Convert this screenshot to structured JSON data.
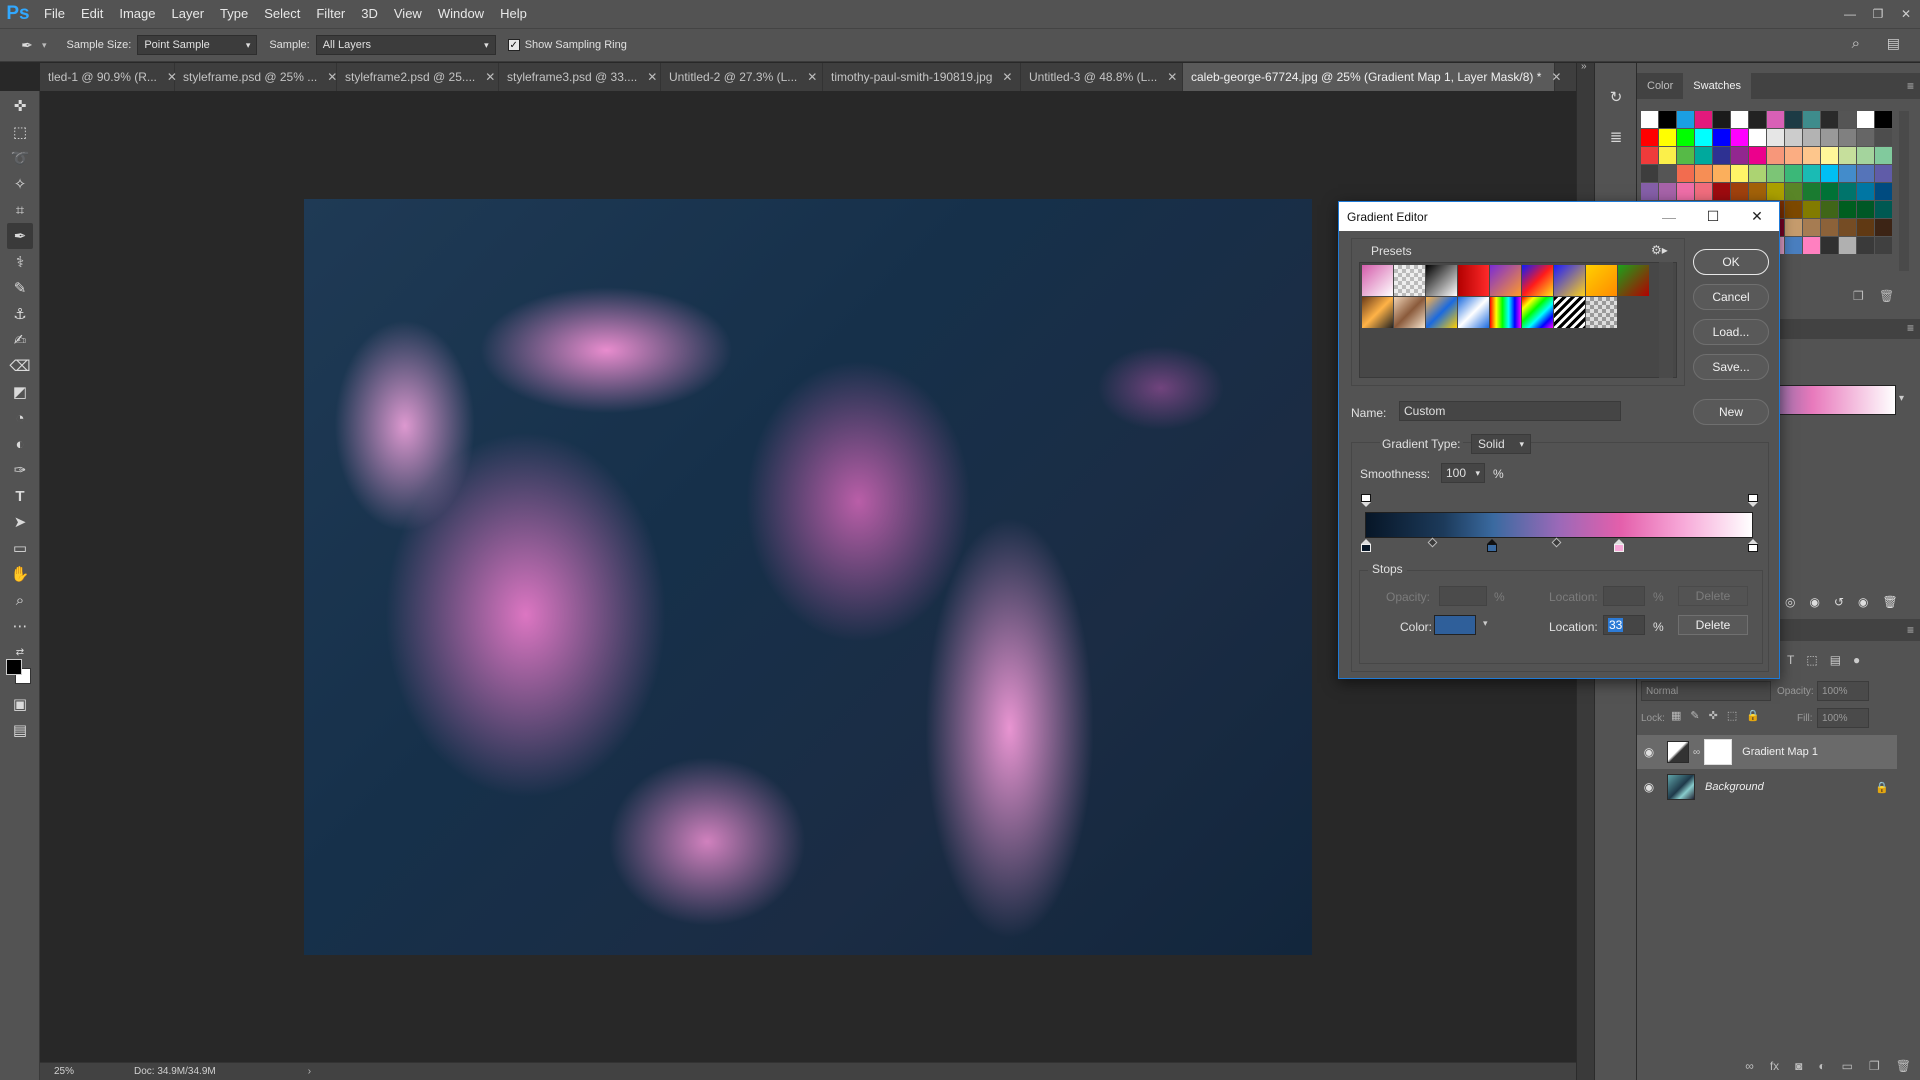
{
  "app": {
    "logo": "Ps"
  },
  "menu": [
    "File",
    "Edit",
    "Image",
    "Layer",
    "Type",
    "Select",
    "Filter",
    "3D",
    "View",
    "Window",
    "Help"
  ],
  "options_bar": {
    "sample_size_label": "Sample Size:",
    "sample_size_value": "Point Sample",
    "sample_label": "Sample:",
    "sample_value": "All Layers",
    "sampling_ring_label": "Show Sampling Ring",
    "sampling_ring_checked": true
  },
  "tabs": [
    {
      "label": "tled-1 @ 90.9% (R...",
      "active": false
    },
    {
      "label": "styleframe.psd @ 25% ...",
      "active": false
    },
    {
      "label": "styleframe2.psd @ 25....",
      "active": false
    },
    {
      "label": "styleframe3.psd @ 33....",
      "active": false
    },
    {
      "label": "Untitled-2 @ 27.3% (L...",
      "active": false
    },
    {
      "label": "timothy-paul-smith-190819.jpg",
      "active": false
    },
    {
      "label": "Untitled-3 @ 48.8% (L...",
      "active": false
    },
    {
      "label": "caleb-george-67724.jpg @ 25% (Gradient Map 1, Layer Mask/8) *",
      "active": true
    }
  ],
  "status": {
    "zoom": "25%",
    "doc": "Doc: 34.9M/34.9M"
  },
  "panels": {
    "color_tab": "Color",
    "swatches_tab": "Swatches"
  },
  "swatch_colors": [
    "#ffffff",
    "#000000",
    "#1a9fe3",
    "#e3197c",
    "#1b1b1b",
    "#ffffff",
    "#222222",
    "#d860b6",
    "#1d3b45",
    "#3e8c8c",
    "#2a2a2a",
    "#555555",
    "#ffffff",
    "#000000",
    "#ff0000",
    "#ffff00",
    "#00ff00",
    "#00ffff",
    "#0000ff",
    "#ff00ff",
    "#ffffff",
    "#e6e6e6",
    "#cccccc",
    "#b3b3b3",
    "#999999",
    "#808080",
    "#666666",
    "#4d4d4d",
    "#ef3b3b",
    "#fbef4a",
    "#56ba47",
    "#00a99d",
    "#2e3192",
    "#92278f",
    "#ec008c",
    "#f7977a",
    "#fbad82",
    "#fdc68c",
    "#fff799",
    "#c6df9c",
    "#a4d49d",
    "#81ca9d",
    "#3d3d3d",
    "#555555",
    "#f26c4f",
    "#f68e55",
    "#fbaf5c",
    "#fff467",
    "#acd372",
    "#7cc576",
    "#3bb878",
    "#1abbb4",
    "#00bff3",
    "#438ccb",
    "#5574b9",
    "#605ca8",
    "#855fa8",
    "#a763a9",
    "#ef6ea8",
    "#f16d7e",
    "#9e0b0f",
    "#a0410d",
    "#a36209",
    "#aba000",
    "#598527",
    "#1a7b30",
    "#007236",
    "#00746b",
    "#0076a3",
    "#004b80",
    "#003471",
    "#1b1464",
    "#440e62",
    "#630460",
    "#9e005d",
    "#9e0039",
    "#790000",
    "#7b2e00",
    "#7d4900",
    "#827b00",
    "#406618",
    "#005e20",
    "#005826",
    "#005952",
    "#005b7f",
    "#003663",
    "#002157",
    "#0d004c",
    "#32004b",
    "#4b0049",
    "#7b0046",
    "#7a0026",
    "#c69c6d",
    "#a67c52",
    "#8c6239",
    "#754c24",
    "#603913",
    "#3c2415",
    "#a0410d",
    "#7d4900",
    "#8c6239",
    "#3c2415",
    "#c69c6d",
    "#603913",
    "#1a1a1a",
    "#e5a0c9",
    "#4a7fc0",
    "#ff80c0",
    "#303030",
    "#b0b0b0",
    "#3a3a3a",
    "#404040"
  ],
  "layers": {
    "blend_mode": "Normal",
    "opacity_label": "Opacity:",
    "opacity_value": "100%",
    "lock_label": "Lock:",
    "fill_label": "Fill:",
    "fill_value": "100%",
    "items": [
      {
        "name": "Gradient Map 1",
        "selected": true
      },
      {
        "name": "Background",
        "selected": false
      }
    ]
  },
  "gradient_editor": {
    "title": "Gradient Editor",
    "presets_label": "Presets",
    "buttons": {
      "ok": "OK",
      "cancel": "Cancel",
      "load": "Load...",
      "save": "Save...",
      "new": "New"
    },
    "name_label": "Name:",
    "name_value": "Custom",
    "gradient_type_label": "Gradient Type:",
    "gradient_type_value": "Solid",
    "smoothness_label": "Smoothness:",
    "smoothness_value": "100",
    "smoothness_unit": "%",
    "stops_label": "Stops",
    "opacity_label": "Opacity:",
    "opacity_unit": "%",
    "location_label": "Location:",
    "location_unit": "%",
    "delete_label": "Delete",
    "color_label": "Color:",
    "color_value": "#2f5f9a",
    "location_value": "33"
  },
  "preset_gradients": [
    "linear-gradient(135deg,#d45cab,#ffffff)",
    "repeating-conic-gradient(#bbb 0 25%,#eee 0 50%) 0 0/8px 8px",
    "linear-gradient(135deg,#000,#fff)",
    "linear-gradient(to right,#b30000,#ff2a2a)",
    "linear-gradient(135deg,#7a2bd6,#ff9a2a)",
    "linear-gradient(135deg,#0b1bff,#ff1b1b,#ffe21b)",
    "linear-gradient(135deg,#1b1bff,#ffd21b)",
    "linear-gradient(135deg,#ffd000,#ff8a00)",
    "linear-gradient(135deg,#1aa31a,#b30000)",
    "linear-gradient(135deg,#6a3b1a,#ffb347,#222)",
    "linear-gradient(135deg,#eed2b5,#8a5a3b,#f5e3cc)",
    "linear-gradient(135deg,#ffb347,#1a6adf,#ffd000)",
    "linear-gradient(135deg,#1a6adf,#ffffff,#1a6adf)",
    "linear-gradient(90deg,#ff0000,#ffff00,#00ff00,#00ffff,#0000ff,#ff00ff)",
    "linear-gradient(135deg,#ff0000,#ffff00,#00ff00,#00ffff,#0000ff,#ff00ff)",
    "repeating-linear-gradient(135deg,#000 0 3px,#fff 3px 6px)",
    "repeating-conic-gradient(#999 0 25%,#ddd 0 50%) 0 0/8px 8px"
  ]
}
